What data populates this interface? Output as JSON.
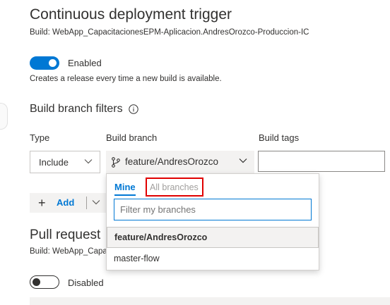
{
  "cd_trigger": {
    "title": "Continuous deployment trigger",
    "build": "Build: WebApp_CapacitacionesEPM-Aplicacion.AndresOrozco-Produccion-IC",
    "toggle_label": "Enabled",
    "toggle_on": true,
    "description": "Creates a release every time a new build is available."
  },
  "filters": {
    "section_title": "Build branch filters",
    "columns": {
      "type": "Type",
      "branch": "Build branch",
      "tags": "Build tags"
    },
    "row": {
      "type_value": "Include",
      "branch_value": "feature/AndresOrozco",
      "tags_value": ""
    },
    "add_label": "Add"
  },
  "dropdown": {
    "tabs": [
      "Mine",
      "All branches"
    ],
    "active_tab": "Mine",
    "filter_placeholder": "Filter my branches",
    "options": [
      "feature/AndresOrozco",
      "master-flow"
    ],
    "selected": "feature/AndresOrozco"
  },
  "pr_trigger": {
    "title": "Pull request",
    "build": "Build: WebApp_Capa",
    "toggle_label": "Disabled",
    "toggle_on": false
  },
  "colors": {
    "accent": "#0078d4",
    "highlight_border": "#e00000"
  },
  "icons": [
    "info-icon",
    "chevron-down-icon",
    "branch-icon",
    "plus-icon"
  ]
}
